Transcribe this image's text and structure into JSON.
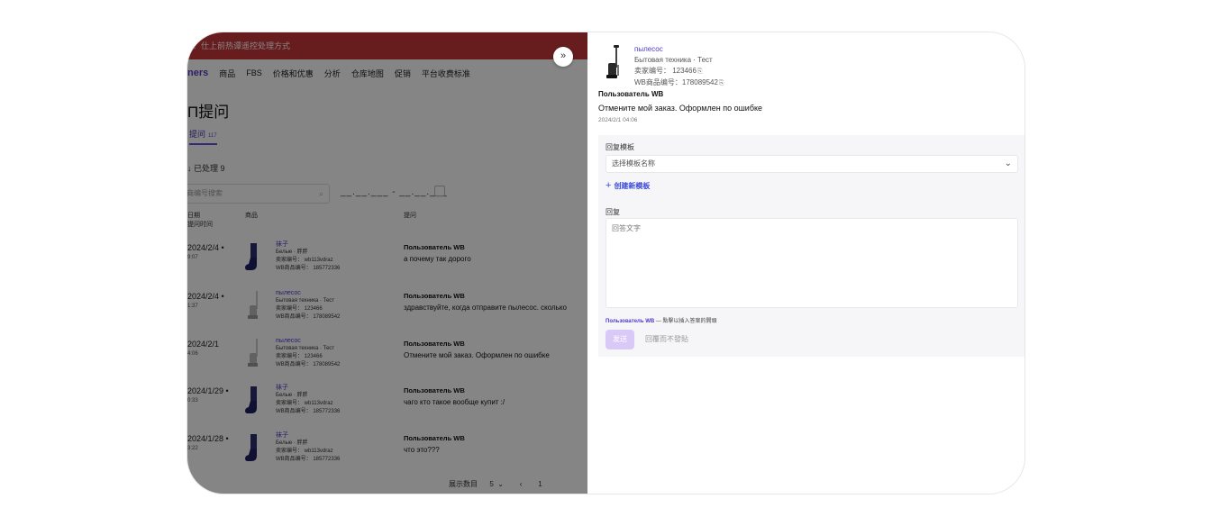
{
  "background": {
    "banner": "？仕上前热谭遥控处理方式",
    "brand": "ners",
    "nav": [
      "商品",
      "FBS",
      "价格和优惠",
      "分析",
      "仓库地图",
      "促销",
      "平台收费标准"
    ],
    "page_title": "П提问",
    "tab_label": "提问",
    "tab_count": "117",
    "filter_text": "↓   已处理  9",
    "search_placeholder": "商编号搜索",
    "date_range": "__.__.___ - __.__.___",
    "columns": {
      "date": "日期\n提问时间",
      "product": "商品",
      "question": "提问"
    },
    "rows": [
      {
        "date": "2024/2/4 •",
        "time": "9:07",
        "product": "袜子",
        "category": "Белые · 胖胖",
        "seller_sku": "卖家编号： wb113vdraz",
        "wb_sku": "WB商品编号： 185772336",
        "user": "Пользователь WB",
        "question": "а почему так дорого"
      },
      {
        "date": "2024/2/4 •",
        "time": "1:37",
        "product": "пылесос",
        "category": "Бытовая техника · Тест",
        "seller_sku": "卖家编号： 123466",
        "wb_sku": "WB商品编号： 178089542",
        "user": "Пользователь WB",
        "question": "здравствуйте, когда отправите пылесос. сколько"
      },
      {
        "date": "2024/2/1",
        "time": "4:06",
        "product": "пылесос",
        "category": "Бытовая техника · Тест",
        "seller_sku": "卖家编号： 123466",
        "wb_sku": "WB商品编号： 178089542",
        "user": "Пользователь WB",
        "question": "Отмените мой заказ. Оформлен по ошибке"
      },
      {
        "date": "2024/1/29 •",
        "time": "0:33",
        "product": "袜子",
        "category": "Белые · 胖胖",
        "seller_sku": "卖家编号： wb113vdraz",
        "wb_sku": "WB商品编号： 185772336",
        "user": "Пользователь WB",
        "question": "чаго кто такое вообще купит :/"
      },
      {
        "date": "2024/1/28 •",
        "time": "3:22",
        "product": "袜子",
        "category": "Белые · 胖胖",
        "seller_sku": "卖家编号： wb113vdraz",
        "wb_sku": "WB商品编号： 185772336",
        "user": "Пользователь WB",
        "question": "что это???"
      }
    ],
    "pager": {
      "label": "展示数目",
      "page_size": "5",
      "page": "1"
    }
  },
  "drawer": {
    "collapse_icon": "»",
    "product": {
      "name": "пылесос",
      "category": "Бытовая техника · Тест",
      "seller_sku_label": "卖家编号：",
      "seller_sku": "123466",
      "wb_sku_label": "WB商品编号：",
      "wb_sku": "178089542"
    },
    "user": "Пользователь WB",
    "question": "Отмените мой заказ. Оформлен по ошибке",
    "time": "2024/2/1 04:06",
    "template_label": "回复模板",
    "template_placeholder": "选择模板名称",
    "create_template": "创建新模板",
    "reply_label": "回复",
    "reply_placeholder": "回答文字",
    "hint_user": "Пользователь WB",
    "hint_text": " — 點擊以插入答案的開頭",
    "send_label": "发送",
    "no_post_label": "回覆而不發貼"
  },
  "colors": {
    "accent": "#4b3bc7",
    "banner": "#c6373a",
    "send_disabled": "#d9c9f7"
  }
}
